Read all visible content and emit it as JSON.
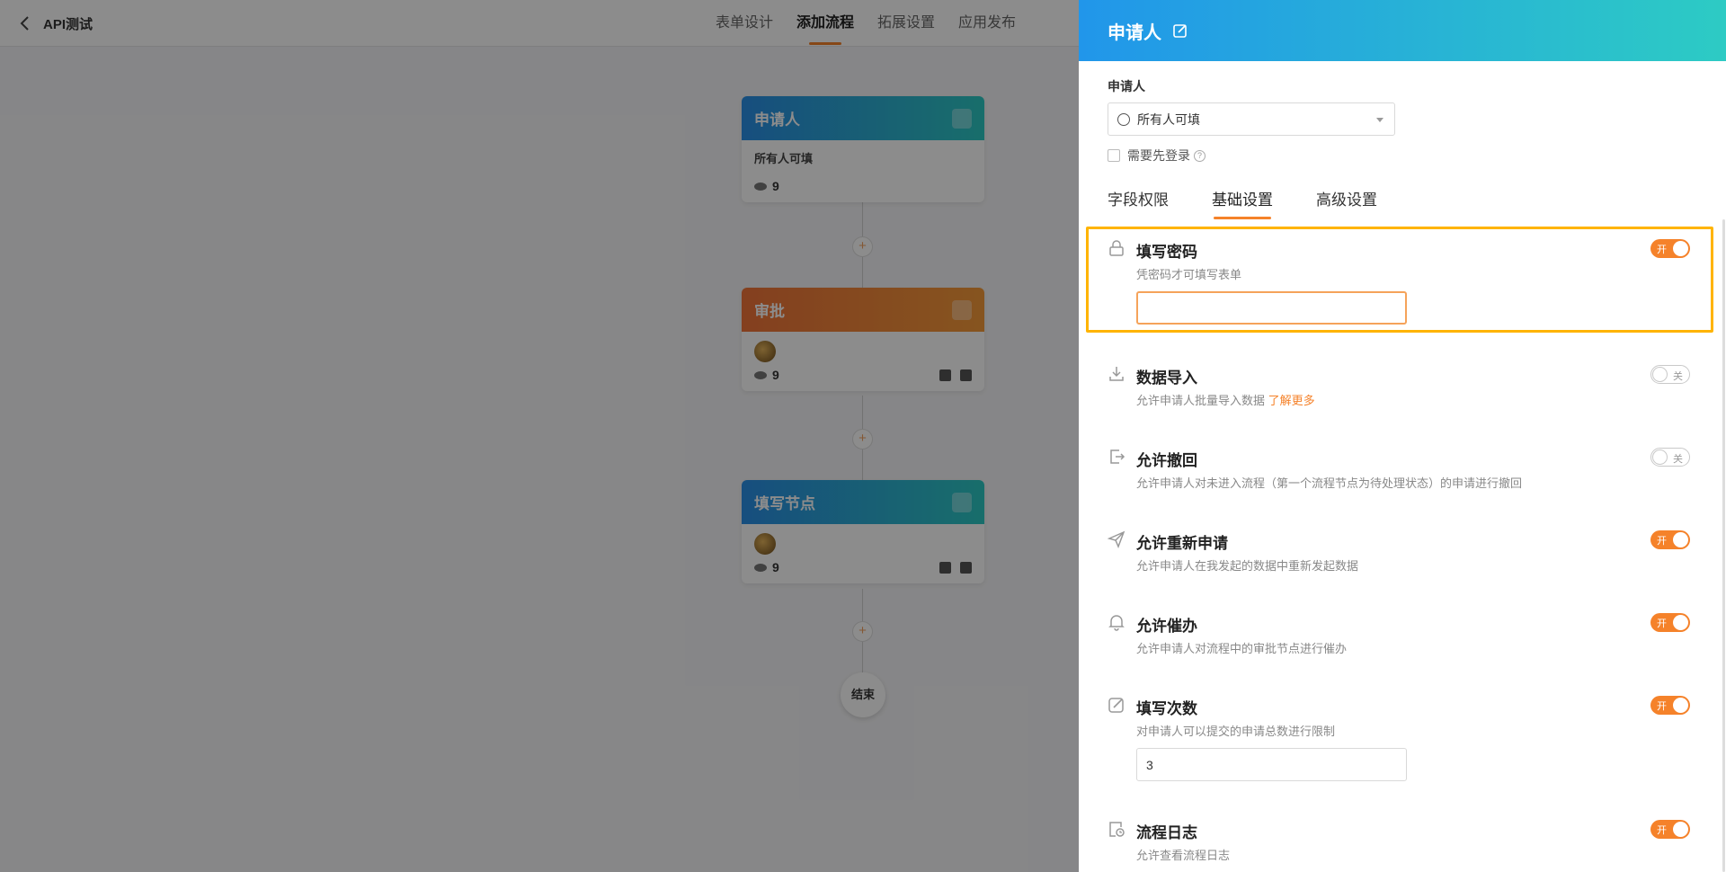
{
  "topbar": {
    "app_title": "API测试",
    "tabs": [
      {
        "label": "表单设计"
      },
      {
        "label": "添加流程"
      },
      {
        "label": "拓展设置"
      },
      {
        "label": "应用发布"
      }
    ],
    "active_tab": "添加流程"
  },
  "flow": {
    "nodes": [
      {
        "title": "申请人",
        "subtitle": "所有人可填",
        "count": "9"
      },
      {
        "title": "审批",
        "count": "9"
      },
      {
        "title": "填写节点",
        "count": "9"
      }
    ],
    "add_symbol": "+",
    "end_label": "结束"
  },
  "drawer": {
    "title": "申请人",
    "applicant_label": "申请人",
    "applicant_select_value": "所有人可填",
    "login_label": "需要先登录",
    "login_help": "?",
    "subtabs": [
      {
        "label": "字段权限"
      },
      {
        "label": "基础设置"
      },
      {
        "label": "高级设置"
      }
    ],
    "active_subtab": "基础设置",
    "toggle_on_label": "开",
    "toggle_off_label": "关",
    "settings": {
      "password": {
        "title": "填写密码",
        "desc": "凭密码才可填写表单",
        "enabled": true,
        "value": ""
      },
      "import": {
        "title": "数据导入",
        "desc": "允许申请人批量导入数据",
        "link": "了解更多",
        "enabled": false
      },
      "withdraw": {
        "title": "允许撤回",
        "desc": "允许申请人对未进入流程（第一个流程节点为待处理状态）的申请进行撤回",
        "enabled": false
      },
      "reapply": {
        "title": "允许重新申请",
        "desc": "允许申请人在我发起的数据中重新发起数据",
        "enabled": true
      },
      "urge": {
        "title": "允许催办",
        "desc": "允许申请人对流程中的审批节点进行催办",
        "enabled": true
      },
      "times": {
        "title": "填写次数",
        "desc": "对申请人可以提交的申请总数进行限制",
        "enabled": true,
        "value": "3"
      },
      "log": {
        "title": "流程日志",
        "desc": "允许查看流程日志",
        "enabled": true
      }
    }
  },
  "colors": {
    "accent": "#f5822a",
    "highlight": "#ffb400",
    "header_gradient_start": "#2196ea",
    "header_gradient_end": "#2dcbc4",
    "approval_orange": "#f0743a"
  }
}
